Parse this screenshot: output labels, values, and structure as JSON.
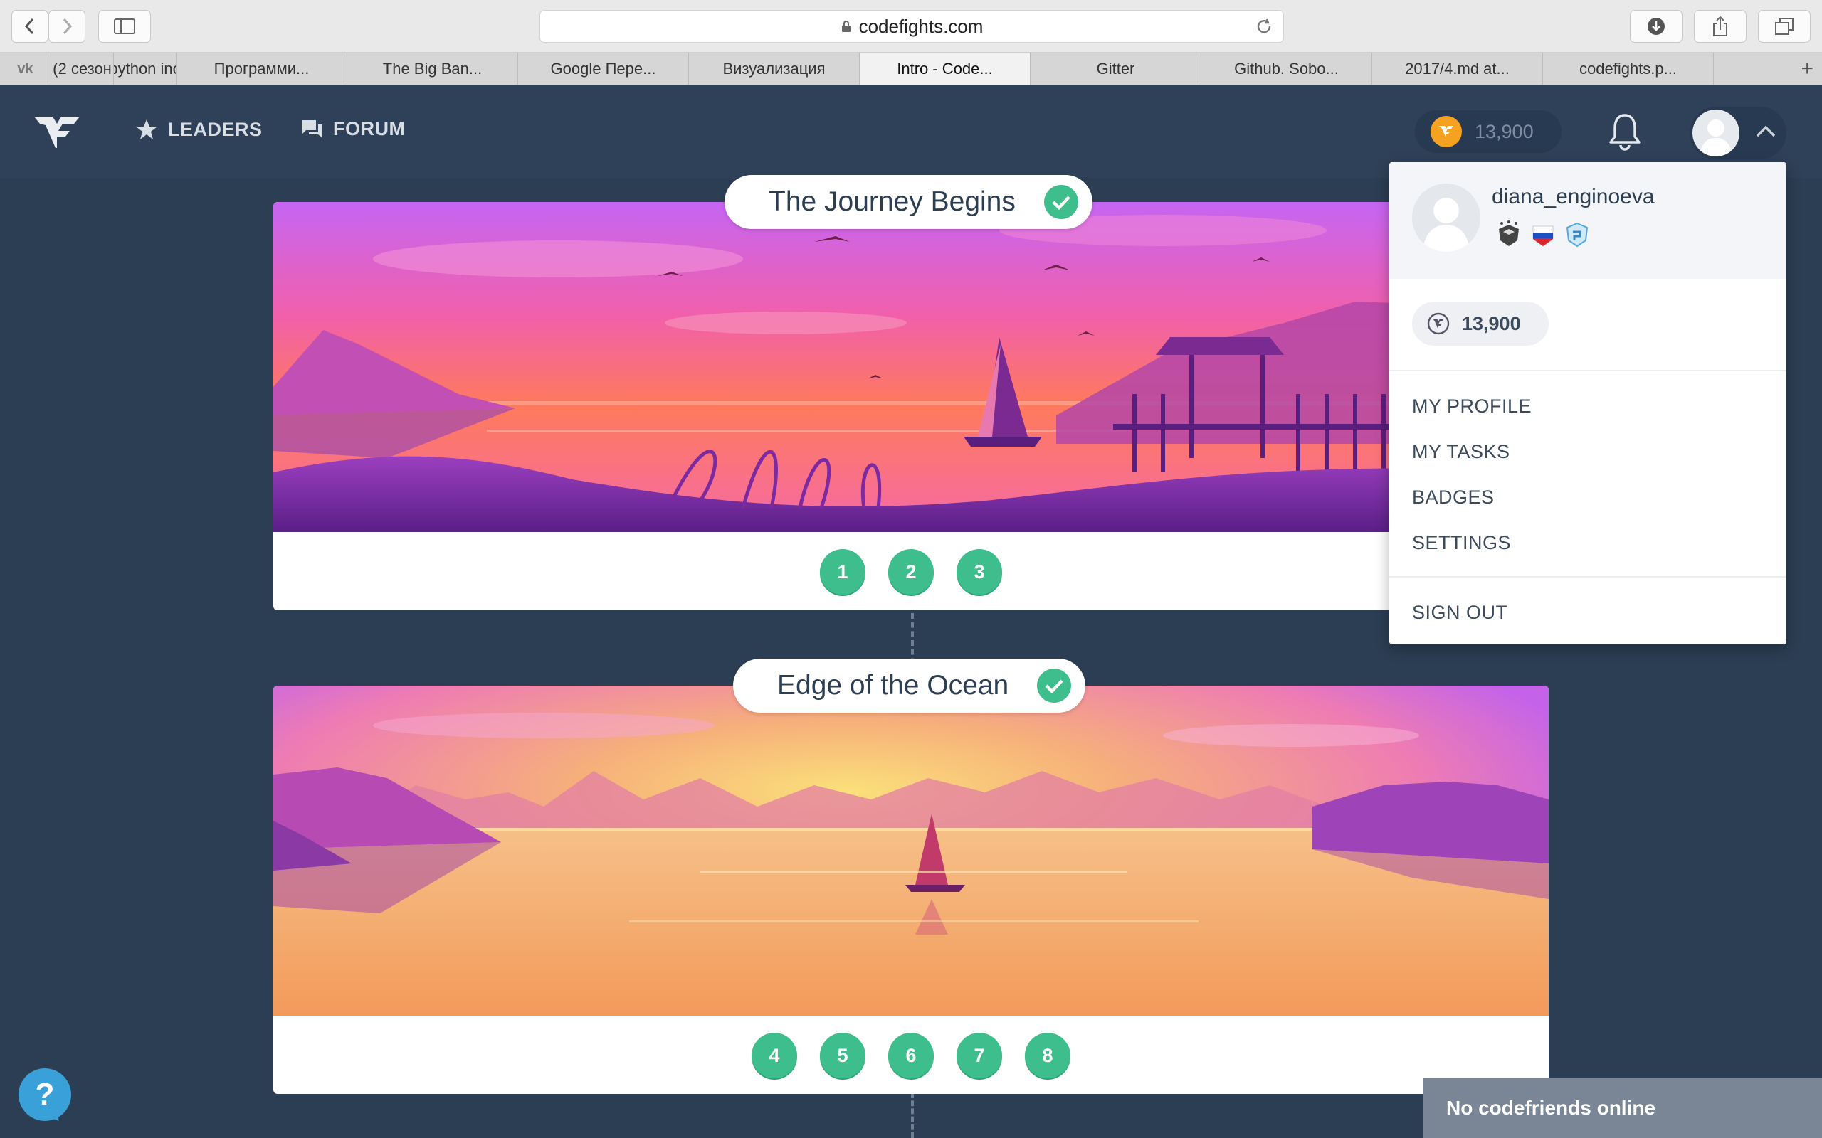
{
  "browser": {
    "url": "codefights.com",
    "tabs": [
      {
        "label": "(2 сезон",
        "active": false
      },
      {
        "label": "python inc",
        "active": false
      },
      {
        "label": "Программи...",
        "active": false
      },
      {
        "label": "The Big Ban...",
        "active": false
      },
      {
        "label": "Google Пере...",
        "active": false
      },
      {
        "label": "Визуализация",
        "active": false
      },
      {
        "label": "Intro - Code...",
        "active": true
      },
      {
        "label": "Gitter",
        "active": false
      },
      {
        "label": "Github. Sobo...",
        "active": false
      },
      {
        "label": "2017/4.md at...",
        "active": false
      },
      {
        "label": "codefights.p...",
        "active": false
      }
    ],
    "pinned_tab_icon": "vk-icon",
    "new_tab_label": "+"
  },
  "header": {
    "nav": [
      {
        "label": "LEADERS",
        "icon": "star-icon"
      },
      {
        "label": "FORUM",
        "icon": "chat-icon"
      }
    ],
    "coins": "13,900"
  },
  "levels": [
    {
      "title": "The Journey Begins",
      "completed": true,
      "tasks": [
        "1",
        "2",
        "3"
      ]
    },
    {
      "title": "Edge of the Ocean",
      "completed": true,
      "tasks": [
        "4",
        "5",
        "6",
        "7",
        "8"
      ]
    }
  ],
  "dropdown": {
    "username": "diana_enginoeva",
    "coins": "13,900",
    "menu": [
      "MY PROFILE",
      "MY TASKS",
      "BADGES",
      "SETTINGS"
    ],
    "sign_out": "SIGN OUT"
  },
  "help_label": "?",
  "friends_status": "No codefriends online",
  "colors": {
    "page_bg": "#2c3e54",
    "header_bg": "#2f4158",
    "accent_green": "#3dbe8c",
    "coin_orange": "#f4a21f"
  }
}
